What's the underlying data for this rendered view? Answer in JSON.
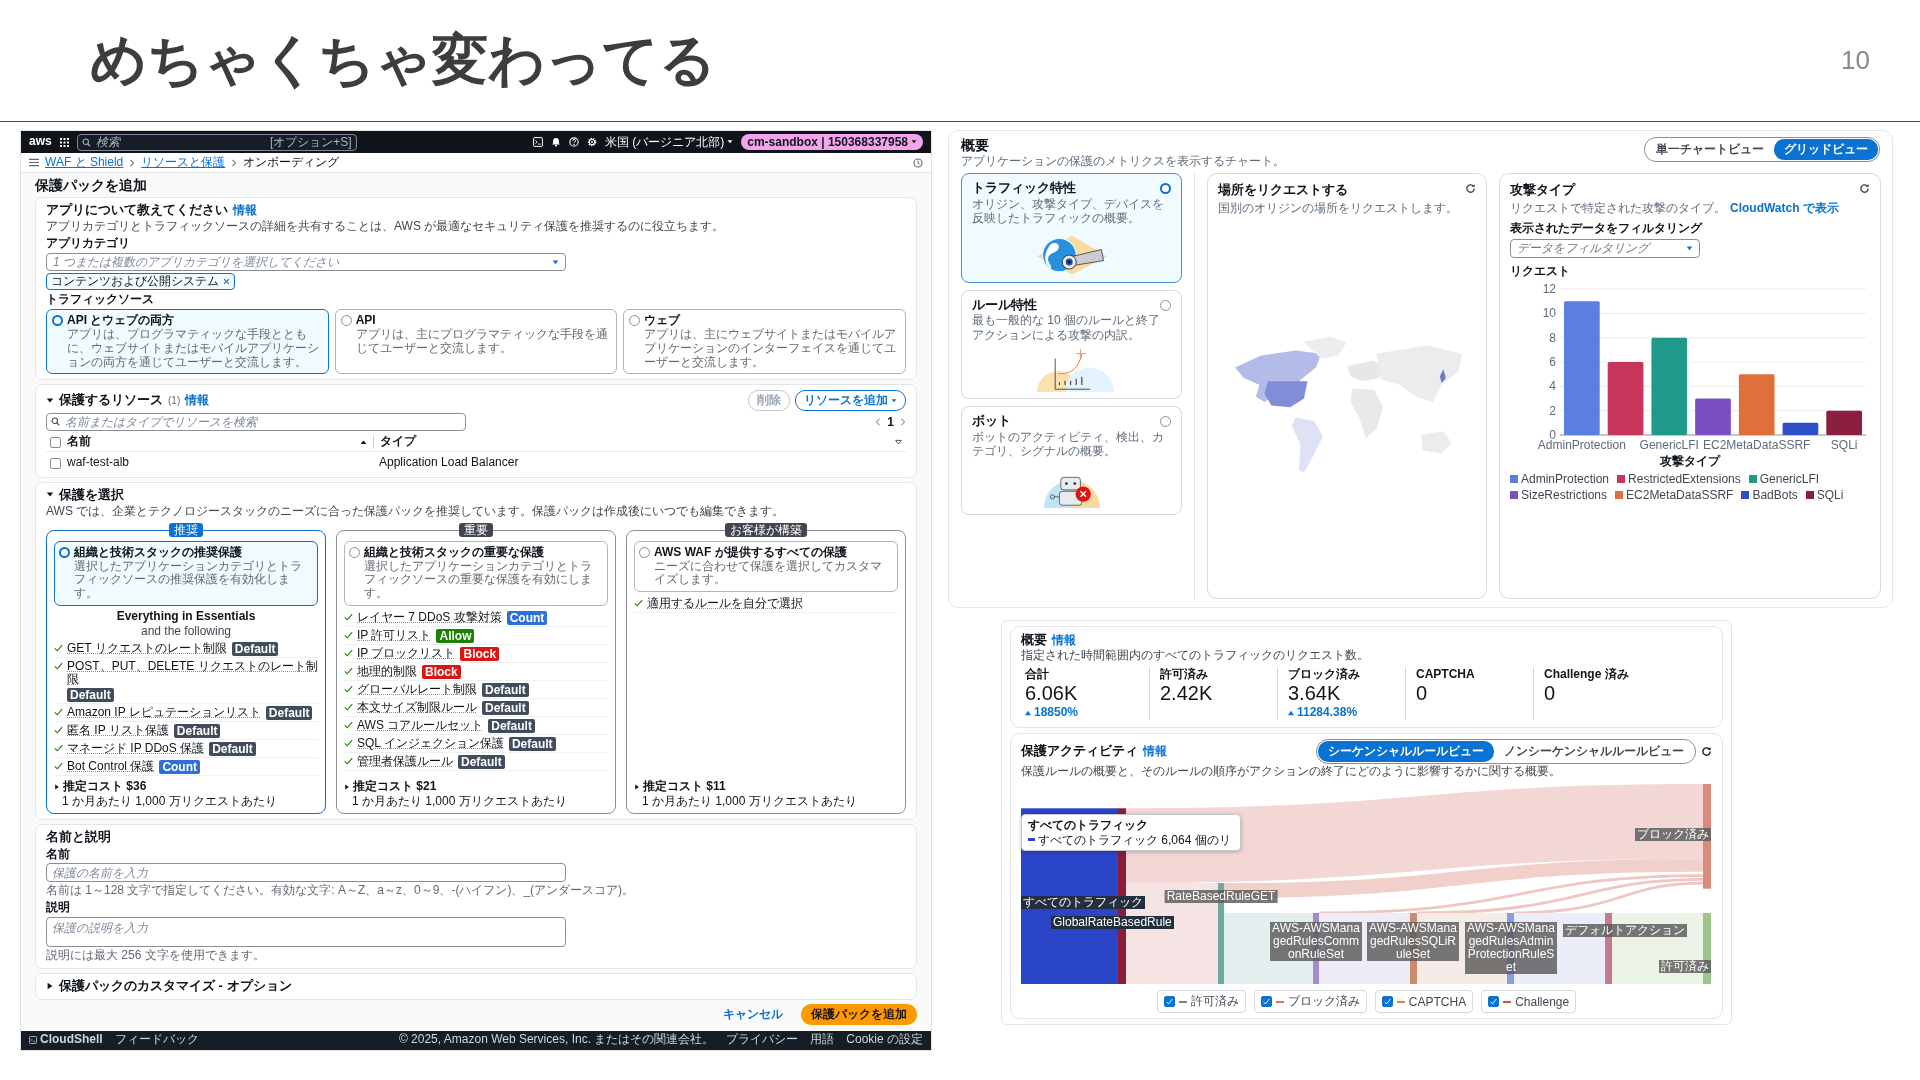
{
  "slide": {
    "title": "めちゃくちゃ変わってる",
    "page_number": "10"
  },
  "console": {
    "top_bar": {
      "logo": "aws",
      "search_placeholder": "検索",
      "search_shortcut": "[オプション+S]",
      "region": "米国 (バージニア北部)",
      "account": "cm-sandbox | 150368337958"
    },
    "breadcrumbs": [
      {
        "label": "WAF と Shield",
        "link": true
      },
      {
        "label": "リソースと保護",
        "link": true
      },
      {
        "label": "オンボーディング",
        "link": false
      }
    ],
    "page_title": "保護パックを追加",
    "app_section": {
      "title": "アプリについて教えてください",
      "info": "情報",
      "description": "アプリカテゴリとトラフィックソースの詳細を共有することは、AWS が最適なセキュリティ保護を推奨するのに役立ちます。",
      "category_label": "アプリカテゴリ",
      "category_placeholder": "1 つまたは複数のアプリカテゴリを選択してください",
      "tokens": [
        "コンテンツおよび公開システム"
      ],
      "traffic_label": "トラフィックソース",
      "traffic_options": [
        {
          "label": "API とウェブの両方",
          "description": "アプリは、プログラマティックな手段とともに、ウェブサイトまたはモバイルアプリケーションの両方を通じてユーザーと交流します。",
          "selected": true
        },
        {
          "label": "API",
          "description": "アプリは、主にプログラマティックな手段を通じてユーザーと交流します。",
          "selected": false
        },
        {
          "label": "ウェブ",
          "description": "アプリは、主にウェブサイトまたはモバイルアプリケーションのインターフェイスを通じてユーザーと交流します。",
          "selected": false
        }
      ]
    },
    "resources": {
      "title": "保護するリソース",
      "count": "(1)",
      "info": "情報",
      "expanded": true,
      "delete_button": "削除",
      "add_button": "リソースを追加",
      "search_placeholder": "名前またはタイプでリソースを検索",
      "page": "1",
      "select_all_checked": false,
      "columns": [
        "名前",
        "タイプ"
      ],
      "rows": [
        {
          "name": "waf-test-alb",
          "type": "Application Load Balancer",
          "checked": false
        }
      ]
    },
    "protection": {
      "title": "保護を選択",
      "expanded": true,
      "description": "AWS では、企業とテクノロジースタックのニーズに合った保護パックを推奨しています。保護パックは作成後にいつでも編集できます。",
      "options": [
        {
          "badge": "推奨",
          "title": "組織と技術スタックの推奨保護",
          "description": "選択したアプリケーションカテゴリとトラフィックソースの推奨保護を有効化します。",
          "selected": true,
          "heading": "Everything in Essentials",
          "subheading": "and the following",
          "rules": [
            {
              "label": "GET リクエストのレート制限",
              "tag": "Default",
              "color": "#414d5c"
            },
            {
              "label": "POST、PUT、DELETE リクエストのレート制限",
              "tag": "Default",
              "color": "#414d5c"
            },
            {
              "label": "Amazon IP レピュテーションリスト",
              "tag": "Default",
              "color": "#414d5c"
            },
            {
              "label": "匿名 IP リスト保護",
              "tag": "Default",
              "color": "#414d5c"
            },
            {
              "label": "マネージド IP DDoS 保護",
              "tag": "Default",
              "color": "#414d5c"
            },
            {
              "label": "Bot Control 保護",
              "tag": "Count",
              "color": "#2f6fd8"
            }
          ],
          "cost": "推定コスト $36",
          "cost_note": "1 か月あたり 1,000 万リクエストあたり"
        },
        {
          "badge": "重要",
          "title": "組織と技術スタックの重要な保護",
          "description": "選択したアプリケーションカテゴリとトラフィックソースの重要な保護を有効にします。",
          "selected": false,
          "rules": [
            {
              "label": "レイヤー 7 DDoS 攻撃対策",
              "tag": "Count",
              "color": "#2f6fd8"
            },
            {
              "label": "IP 許可リスト",
              "tag": "Allow",
              "color": "#1d8102"
            },
            {
              "label": "IP ブロックリスト",
              "tag": "Block",
              "color": "#d91515"
            },
            {
              "label": "地理的制限",
              "tag": "Block",
              "color": "#d91515"
            },
            {
              "label": "グローバルレート制限",
              "tag": "Default",
              "color": "#414d5c"
            },
            {
              "label": "本文サイズ制限ルール",
              "tag": "Default",
              "color": "#414d5c"
            },
            {
              "label": "AWS コアルールセット",
              "tag": "Default",
              "color": "#414d5c"
            },
            {
              "label": "SQL インジェクション保護",
              "tag": "Default",
              "color": "#414d5c"
            },
            {
              "label": "管理者保護ルール",
              "tag": "Default",
              "color": "#414d5c"
            }
          ],
          "cost": "推定コスト $21",
          "cost_note": "1 か月あたり 1,000 万リクエストあたり"
        },
        {
          "badge": "お客様が構築",
          "title": "AWS WAF が提供するすべての保護",
          "description": "ニーズに合わせて保護を選択してカスタマイズします。",
          "selected": false,
          "rules": [
            {
              "label": "適用するルールを自分で選択"
            }
          ],
          "cost": "推定コスト $11",
          "cost_note": "1 か月あたり 1,000 万リクエストあたり"
        }
      ]
    },
    "name_section": {
      "title": "名前と説明",
      "name_label": "名前",
      "name_placeholder": "保護の名前を入力",
      "name_hint": "名前は 1～128 文字で指定してください。有効な文字: A～Z、a～z、0～9、-(ハイフン)、_(アンダースコア)。",
      "description_label": "説明",
      "description_placeholder": "保護の説明を入力",
      "description_hint": "説明には最大 256 文字を使用できます。"
    },
    "customize": {
      "title": "保護パックのカスタマイズ - オプション",
      "expanded": false
    },
    "actions": {
      "cancel": "キャンセル",
      "submit": "保護パックを追加"
    },
    "footer": {
      "cloudshell": "CloudShell",
      "feedback": "フィードバック",
      "copyright": "© 2025, Amazon Web Services, Inc. またはその関連会社。",
      "links": [
        "プライバシー",
        "用語",
        "Cookie の設定"
      ]
    }
  },
  "overview": {
    "title": "概要",
    "description": "アプリケーションの保護のメトリクスを表示するチャート。",
    "view_toggle": [
      {
        "label": "単一チャートビュー",
        "selected": false
      },
      {
        "label": "グリッドビュー",
        "selected": true
      }
    ],
    "cards": [
      {
        "kind": "traffic",
        "title": "トラフィック特性",
        "description": "オリジン、攻撃タイプ、デバイスを反映したトラフィックの概要。",
        "selected": true
      },
      {
        "kind": "rules",
        "title": "ルール特性",
        "description": "最も一般的な 10 個のルールと終了アクションによる攻撃の内訳。",
        "selected": false
      },
      {
        "kind": "bot",
        "title": "ボット",
        "description": "ボットのアクティビティ、検出、カテゴリ、シグナルの概要。",
        "selected": false
      }
    ],
    "location": {
      "title": "場所をリクエストする",
      "description": "国別のオリジンの場所をリクエストします。"
    },
    "attack_types": {
      "title": "攻撃タイプ",
      "description": "リクエストで特定された攻撃のタイプ。",
      "link": "CloudWatch で表示",
      "filter_label": "表示されたデータをフィルタリング",
      "filter_placeholder": "データをフィルタリング",
      "chart_data": {
        "type": "bar",
        "xlabel": "攻撃タイプ",
        "ylabel": "リクエスト",
        "grid": true,
        "legend": "bottom",
        "categories": [
          "AdminProtection",
          null,
          "GenericLFI",
          null,
          "EC2MetaDataSSRF",
          null,
          "SQLi"
        ],
        "series": [
          {
            "name": "AdminProtection",
            "color": "#5b7fe0",
            "values": [
              11,
              null,
              null,
              null,
              null,
              null,
              null
            ]
          },
          {
            "name": "RestrictedExtensions",
            "color": "#c7355a",
            "values": [
              null,
              6,
              null,
              null,
              null,
              null,
              null
            ]
          },
          {
            "name": "GenericLFI",
            "color": "#1f9a8a",
            "values": [
              null,
              null,
              8,
              null,
              null,
              null,
              null
            ]
          },
          {
            "name": "SizeRestrictions",
            "color": "#7b4fc4",
            "values": [
              null,
              null,
              null,
              3,
              null,
              null,
              null
            ]
          },
          {
            "name": "EC2MetaDataSSRF",
            "color": "#e0703a",
            "values": [
              null,
              null,
              null,
              null,
              5,
              null,
              null
            ]
          },
          {
            "name": "BadBots",
            "color": "#2e4fc9",
            "values": [
              null,
              null,
              null,
              null,
              null,
              1,
              null
            ]
          },
          {
            "name": "SQLi",
            "color": "#8c1f3f",
            "values": [
              null,
              null,
              null,
              null,
              null,
              null,
              2
            ]
          }
        ],
        "ylim": [
          0,
          12
        ],
        "yticks": [
          0,
          2,
          4,
          6,
          8,
          10,
          12
        ]
      }
    }
  },
  "protection_summary": {
    "title": "概要",
    "info": "情報",
    "description": "指定された時間範囲内のすべてのトラフィックのリクエスト数。",
    "metrics": [
      {
        "label": "合計",
        "value": "6.06K",
        "change": "18850%"
      },
      {
        "label": "許可済み",
        "value": "2.42K"
      },
      {
        "label": "ブロック済み",
        "value": "3.64K",
        "change": "11284.38%"
      },
      {
        "label": "CAPTCHA",
        "value": "0"
      },
      {
        "label": "Challenge 済み",
        "value": "0"
      }
    ]
  },
  "protection_activity": {
    "title": "保護アクティビティ",
    "info": "情報",
    "description": "保護ルールの概要と、そのルールの順序がアクションの終了にどのように影響するかに関する概要。",
    "view_toggle": [
      {
        "label": "シーケンシャルルールビュー",
        "selected": true
      },
      {
        "label": "ノンシーケンシャルルールビュー",
        "selected": false
      }
    ],
    "nodes": [
      {
        "label": "すべてのトラフィック",
        "kind": "source"
      },
      {
        "label": "GlobalRateBasedRule",
        "kind": "source"
      },
      {
        "label": "RateBasedRuleGET",
        "kind": "rule"
      },
      {
        "label": "AWS-AWSManagedRulesCommonRuleSet",
        "kind": "rule"
      },
      {
        "label": "AWS-AWSManagedRulesSQLiRuleSet",
        "kind": "rule"
      },
      {
        "label": "AWS-AWSManagedRulesAdminProtectionRuleSet",
        "kind": "rule"
      },
      {
        "label": "ブロック済み",
        "kind": "end"
      },
      {
        "label": "デフォルトアクション",
        "kind": "rule"
      },
      {
        "label": "許可済み",
        "kind": "end"
      }
    ],
    "tooltip": {
      "title": "すべてのトラフィック",
      "line": "すべてのトラフィック 6,064 個のリ"
    },
    "legend": [
      {
        "label": "許可済み",
        "checked": true,
        "color": "#6b8f5e"
      },
      {
        "label": "ブロック済み",
        "checked": true,
        "color": "#d9735e"
      },
      {
        "label": "CAPTCHA",
        "checked": true,
        "color": "#e0843a"
      },
      {
        "label": "Challenge",
        "checked": true,
        "color": "#c9593d"
      }
    ]
  }
}
